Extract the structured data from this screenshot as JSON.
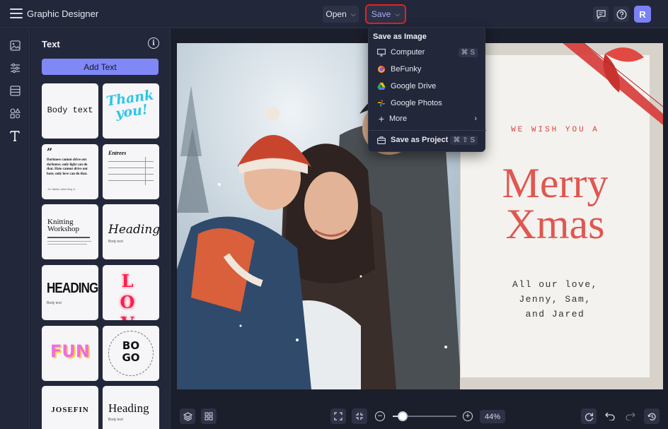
{
  "app": {
    "title": "Graphic Designer"
  },
  "toolbar": {
    "open_label": "Open",
    "save_label": "Save",
    "avatar_letter": "R"
  },
  "panel": {
    "title": "Text",
    "add_text_label": "Add Text",
    "tiles": {
      "body_text": "Body text",
      "thank_you": "Thank you!",
      "quote": "Darkness cannot drive out darkness; only light can do that. Hate cannot drive out hate; only love can do that.",
      "quote_author": "- Dr. Martin Luther King Jr.",
      "entrees": "Entrees",
      "knitting": "Knitting Workshop",
      "heading_script": "Heading",
      "body_small": "Body text",
      "heading_bold": "HEADING",
      "love": "LOVE",
      "fun": "FUN",
      "bogo": "BOGO",
      "josefin": "JOSEFIN",
      "heading_serif": "Heading"
    }
  },
  "card": {
    "wish": "WE WISH YOU A",
    "merry": "Merry",
    "xmas": "Xmas",
    "line1": "All our love,",
    "line2": "Jenny, Sam,",
    "line3": "and Jared"
  },
  "save_menu": {
    "header": "Save as Image",
    "items": [
      {
        "label": "Computer",
        "shortcut": "⌘ S",
        "icon": "monitor-icon"
      },
      {
        "label": "BeFunky",
        "icon": "befunky-icon"
      },
      {
        "label": "Google Drive",
        "icon": "google-drive-icon"
      },
      {
        "label": "Google Photos",
        "icon": "google-photos-icon"
      },
      {
        "label": "More",
        "icon": "plus-icon"
      }
    ],
    "project": {
      "label": "Save as Project",
      "shortcut": "⌘ ⇧ S",
      "icon": "briefcase-icon"
    }
  },
  "zoom": {
    "label": "44%",
    "level": 0.15
  },
  "colors": {
    "accent": "#8088f6",
    "highlight": "#e02424",
    "card_red": "#e05752"
  }
}
